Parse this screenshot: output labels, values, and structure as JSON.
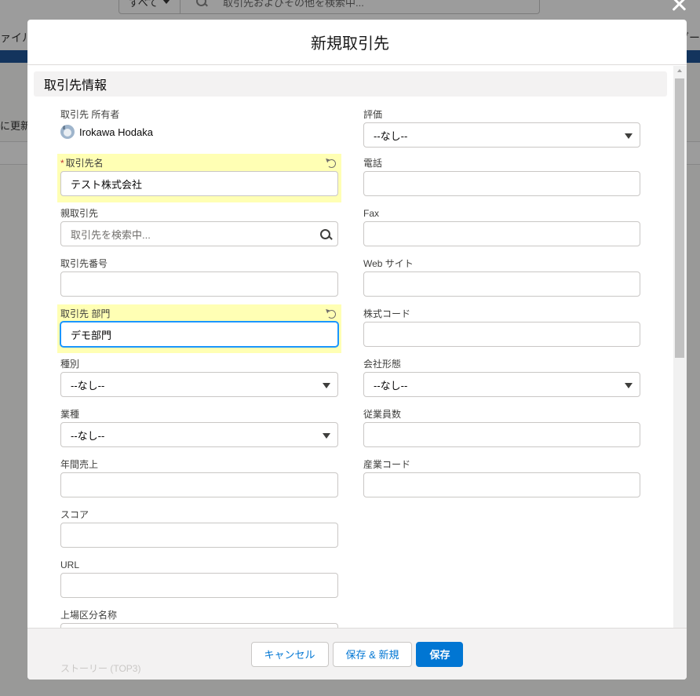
{
  "background": {
    "search_scope": "すべて",
    "search_placeholder": "取引先およびその他を検索中...",
    "tab_left_fragment": "ァイル",
    "tab_right_fragment": "ダー",
    "left_text_fragment": "に更新"
  },
  "modal": {
    "title": "新規取引先",
    "section_title": "取引先情報",
    "left_fields": {
      "owner_label": "取引先 所有者",
      "owner_name": "Irokawa Hodaka",
      "account_name_label": "取引先名",
      "account_name_value": "テスト株式会社",
      "parent_label": "親取引先",
      "parent_placeholder": "取引先を検索中...",
      "account_number_label": "取引先番号",
      "division_label": "取引先 部門",
      "division_value": "デモ部門",
      "type_label": "種別",
      "type_value": "--なし--",
      "industry_label": "業種",
      "industry_value": "--なし--",
      "annual_revenue_label": "年間売上",
      "score_label": "スコア",
      "url_label": "URL",
      "listing_label": "上場区分名称",
      "story_label": "ストーリー (TOP3)"
    },
    "right_fields": {
      "rating_label": "評価",
      "rating_value": "--なし--",
      "phone_label": "電話",
      "fax_label": "Fax",
      "website_label": "Web サイト",
      "ticker_label": "株式コード",
      "ownership_label": "会社形態",
      "ownership_value": "--なし--",
      "employees_label": "従業員数",
      "sic_label": "産業コード"
    },
    "footer": {
      "cancel": "キャンセル",
      "save_new": "保存 & 新規",
      "save": "保存"
    }
  }
}
